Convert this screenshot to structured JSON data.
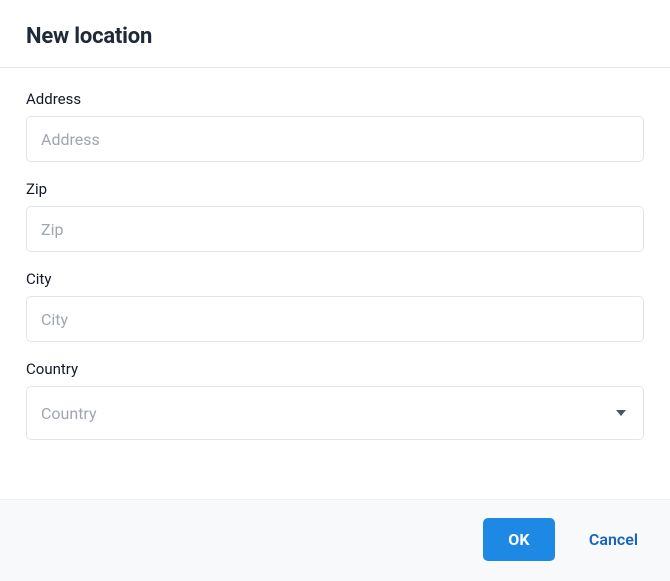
{
  "dialog": {
    "title": "New location"
  },
  "form": {
    "address": {
      "label": "Address",
      "placeholder": "Address",
      "value": ""
    },
    "zip": {
      "label": "Zip",
      "placeholder": "Zip",
      "value": ""
    },
    "city": {
      "label": "City",
      "placeholder": "City",
      "value": ""
    },
    "country": {
      "label": "Country",
      "placeholder": "Country",
      "value": ""
    }
  },
  "footer": {
    "ok_label": "OK",
    "cancel_label": "Cancel"
  }
}
